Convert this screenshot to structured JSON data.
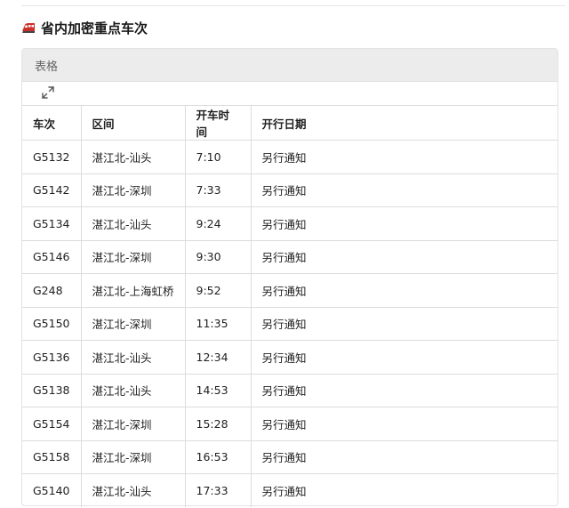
{
  "page": {
    "title": "省内加密重点车次",
    "icon": "train-icon"
  },
  "card": {
    "header_label": "表格",
    "expand_icon": "expand-icon"
  },
  "table": {
    "columns": [
      "车次",
      "区间",
      "开车时间",
      "开行日期"
    ],
    "rows": [
      [
        "G5132",
        "湛江北-汕头",
        "7:10",
        "另行通知"
      ],
      [
        "G5142",
        "湛江北-深圳",
        "7:33",
        "另行通知"
      ],
      [
        "G5134",
        "湛江北-汕头",
        "9:24",
        "另行通知"
      ],
      [
        "G5146",
        "湛江北-深圳",
        "9:30",
        "另行通知"
      ],
      [
        "G248",
        "湛江北-上海虹桥",
        "9:52",
        "另行通知"
      ],
      [
        "G5150",
        "湛江北-深圳",
        "11:35",
        "另行通知"
      ],
      [
        "G5136",
        "湛江北-汕头",
        "12:34",
        "另行通知"
      ],
      [
        "G5138",
        "湛江北-汕头",
        "14:53",
        "另行通知"
      ],
      [
        "G5154",
        "湛江北-深圳",
        "15:28",
        "另行通知"
      ],
      [
        "G5158",
        "湛江北-深圳",
        "16:53",
        "另行通知"
      ],
      [
        "G5140",
        "湛江北-汕头",
        "17:33",
        "另行通知"
      ]
    ]
  }
}
